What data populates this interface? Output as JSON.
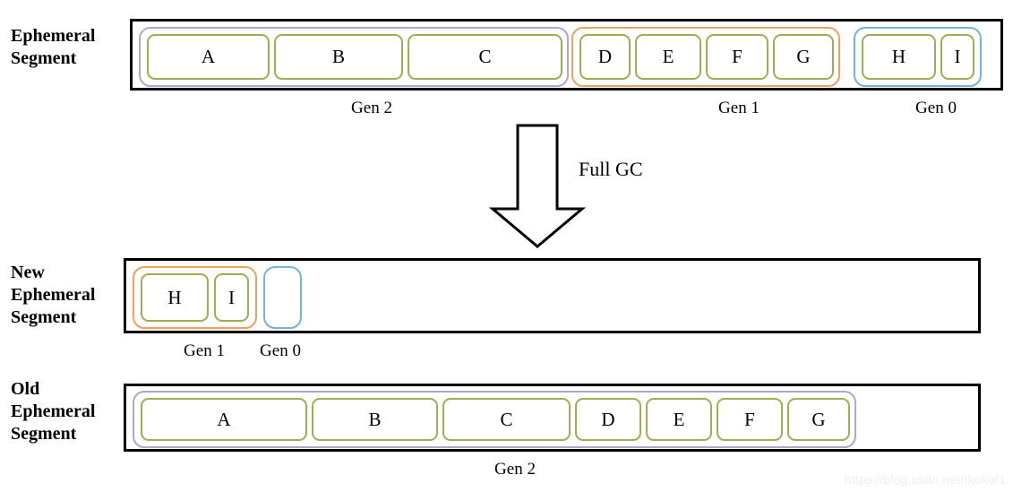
{
  "diagram": {
    "title_labels": {
      "ephemeral_segment": "Ephemeral\nSegment",
      "new_ephemeral_segment": "New\nEphemeral\nSegment",
      "old_ephemeral_segment": "Old\nEphemeral\nSegment"
    },
    "transition": {
      "arrow_label": "Full GC",
      "arrow_direction": "down"
    },
    "colors": {
      "gen2_border": "#b4a5cd",
      "gen1_border": "#f0a15e",
      "gen0_border": "#73b4d7",
      "object_border": "#9cb04f",
      "segment_border": "#000000",
      "text": "#000000"
    },
    "rows": [
      {
        "id": "ephemeral-segment",
        "label": "Ephemeral\nSegment",
        "generations": [
          {
            "name": "Gen 2",
            "color_key": "gen2_border",
            "objects": [
              {
                "label": "A"
              },
              {
                "label": "B"
              },
              {
                "label": "C"
              }
            ]
          },
          {
            "name": "Gen 1",
            "color_key": "gen1_border",
            "objects": [
              {
                "label": "D"
              },
              {
                "label": "E"
              },
              {
                "label": "F"
              },
              {
                "label": "G"
              }
            ]
          },
          {
            "name": "Gen 0",
            "color_key": "gen0_border",
            "objects": [
              {
                "label": "H"
              },
              {
                "label": "I"
              }
            ]
          }
        ]
      },
      {
        "id": "new-ephemeral-segment",
        "label": "New\nEphemeral\nSegment",
        "generations": [
          {
            "name": "Gen 1",
            "color_key": "gen1_border",
            "objects": [
              {
                "label": "H"
              },
              {
                "label": "I"
              }
            ]
          },
          {
            "name": "Gen 0",
            "color_key": "gen0_border",
            "objects": []
          }
        ]
      },
      {
        "id": "old-ephemeral-segment",
        "label": "Old\nEphemeral\nSegment",
        "generations": [
          {
            "name": "Gen 2",
            "color_key": "gen2_border",
            "objects": [
              {
                "label": "A"
              },
              {
                "label": "B"
              },
              {
                "label": "C"
              },
              {
                "label": "D"
              },
              {
                "label": "E"
              },
              {
                "label": "F"
              },
              {
                "label": "G"
              }
            ]
          }
        ]
      }
    ],
    "captions": {
      "row1_gen2": "Gen 2",
      "row1_gen1": "Gen 1",
      "row1_gen0": "Gen 0",
      "row2_gen1": "Gen 1",
      "row2_gen0": "Gen 0",
      "row3_gen2": "Gen 2"
    },
    "watermark": "https://blog.csdn.net/tkokof1"
  }
}
